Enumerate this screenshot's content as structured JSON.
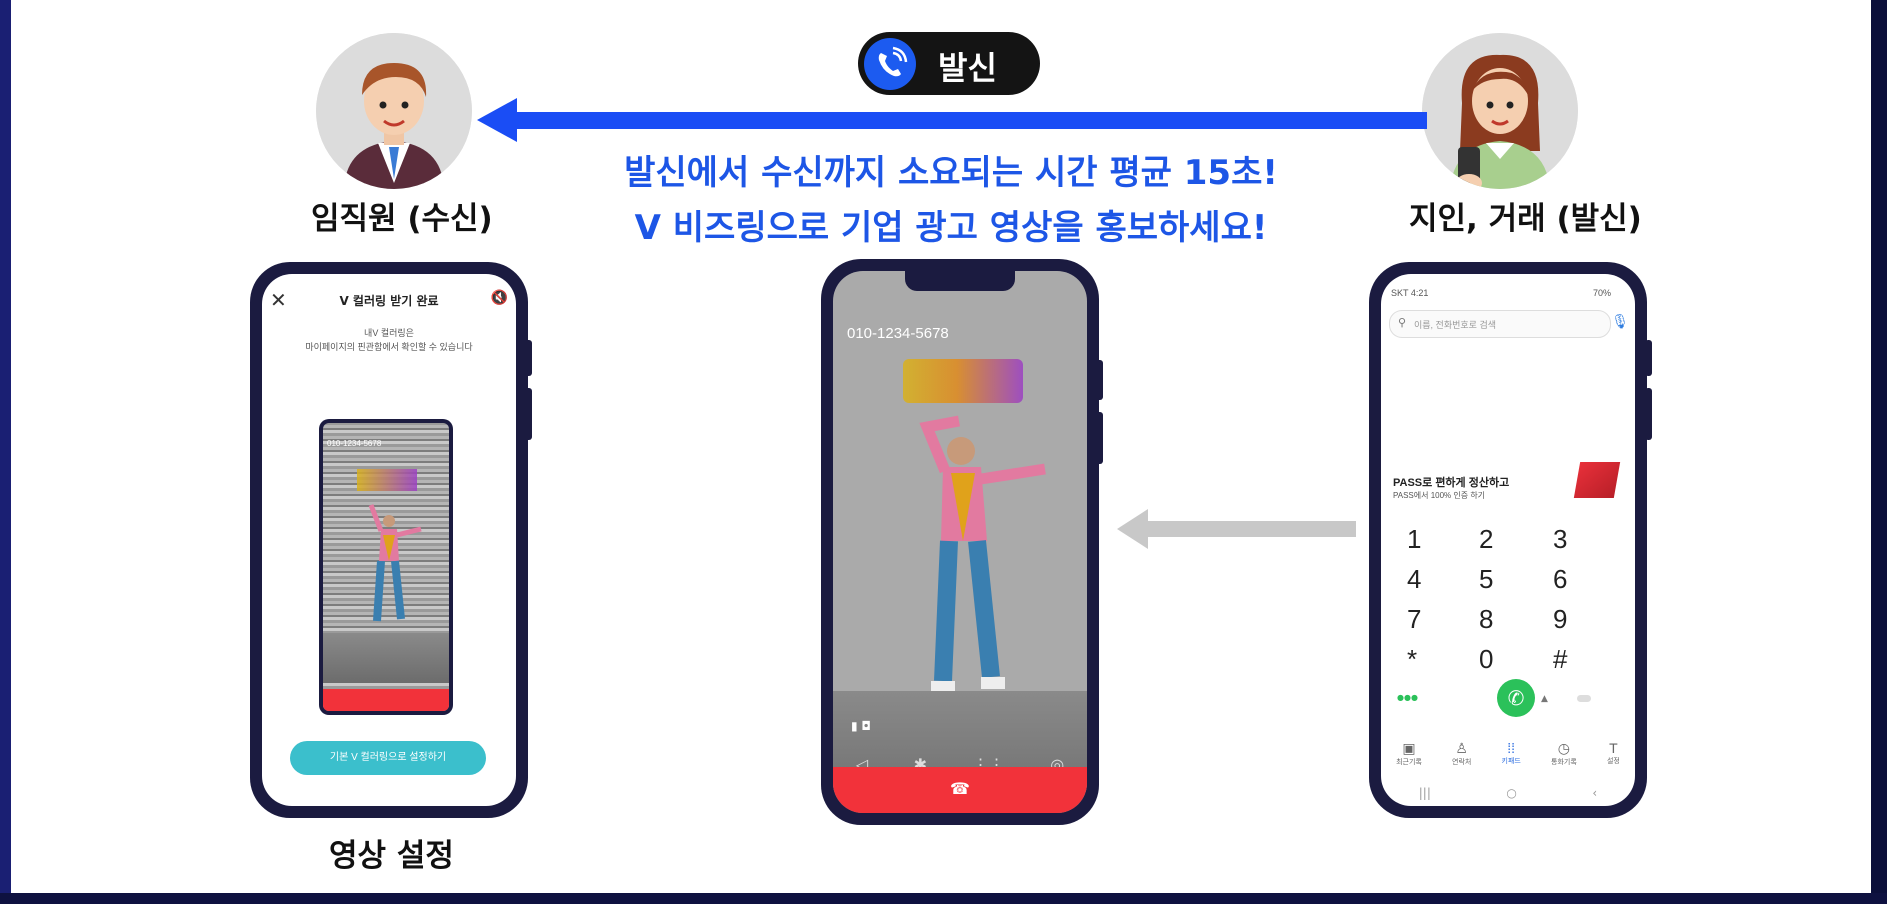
{
  "call_badge": {
    "label": "발신"
  },
  "headline": {
    "line1": "발신에서 수신까지 소요되는 시간 평균 15초!",
    "line2": "V 비즈링으로 기업 광고 영상을 홍보하세요!"
  },
  "people": {
    "receiver_label": "임직원 (수신)",
    "caller_label": "지인, 거래 (발신)"
  },
  "left_phone": {
    "title": "V 컬러링 받기 완료",
    "desc1": "내V 컬러링은",
    "desc2": "마이페이지의 핀관함에서 확인할 수 있습니다",
    "inner_number": "010-1234-5678",
    "button_label": "기본 V 컬러링으로 설정하기"
  },
  "center_phone": {
    "number": "010-1234-5678"
  },
  "right_phone": {
    "status": "SKT 4:21",
    "battery": "70%",
    "search_placeholder": "이름, 전화번호로 검색",
    "banner_title": "PASS로 편하게 정산하고",
    "banner_sub": "PASS에서 100% 인증 하기",
    "keys": [
      "1",
      "2",
      "3",
      "4",
      "5",
      "6",
      "7",
      "8",
      "9",
      "*",
      "0",
      "#"
    ],
    "tabs": [
      "최근기록",
      "연락처",
      "키패드",
      "통화기록",
      "설정"
    ]
  },
  "caption": "영상 설정",
  "colors": {
    "accent_blue": "#1d56e6",
    "arrow_blue": "#1a4df5",
    "end_call_red": "#f2323a",
    "teal_button": "#3bbfcc",
    "green_call": "#2bc15a"
  },
  "icons": [
    "phone-call-icon",
    "close-icon",
    "mute-icon",
    "mic-icon",
    "search-icon",
    "end-call-icon",
    "call-icon"
  ]
}
